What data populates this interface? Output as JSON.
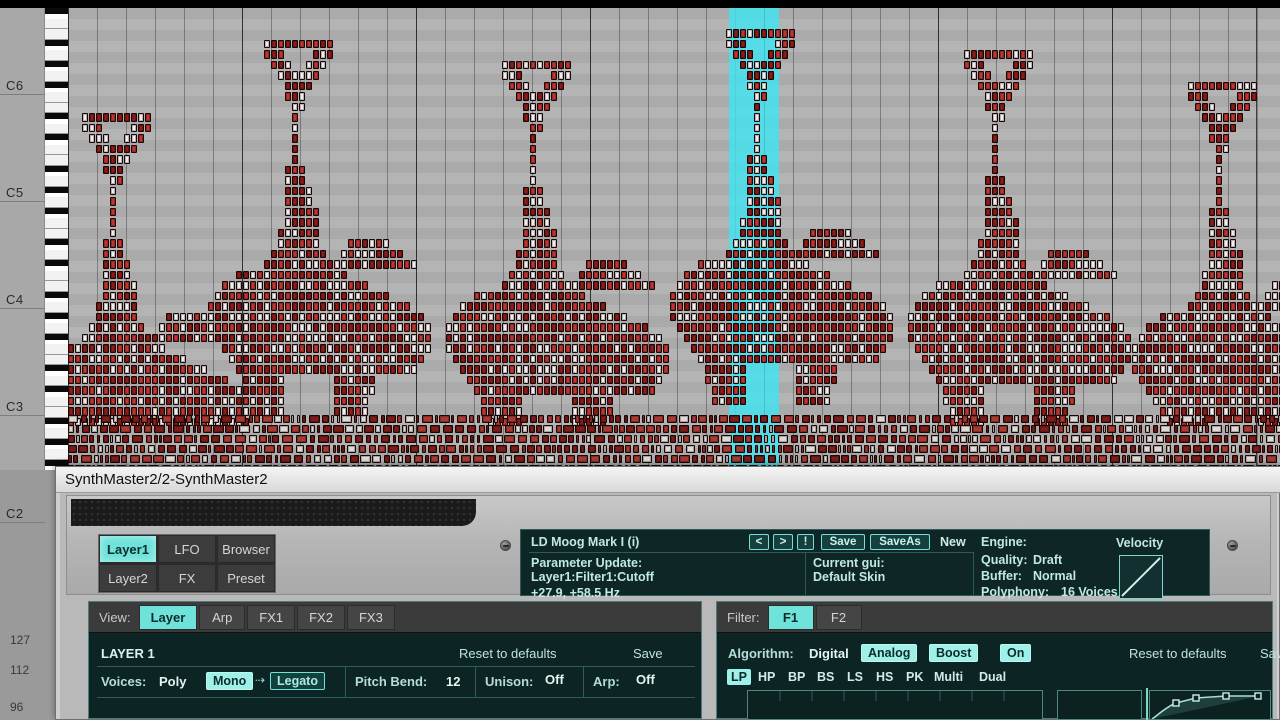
{
  "daw": {
    "octave_labels": [
      "C6",
      "C5",
      "C4",
      "C3",
      "C2"
    ],
    "velocity_labels": [
      "127",
      "112",
      "96"
    ],
    "selection_color": "#3fe4f2",
    "note_color": "#b02020",
    "grid_bg": "#b4b4b4"
  },
  "vst": {
    "window_title": "SynthMaster2/2-SynthMaster2",
    "layer_buttons": [
      {
        "label": "Layer1",
        "active": true
      },
      {
        "label": "LFO",
        "active": false
      },
      {
        "label": "Browser",
        "active": false
      },
      {
        "label": "Layer2",
        "active": false
      },
      {
        "label": "FX",
        "active": false
      },
      {
        "label": "Preset",
        "active": false
      }
    ],
    "lcd": {
      "preset_name": "LD Moog Mark I (i)",
      "nav_prev": "<",
      "nav_next": ">",
      "nav_info": "!",
      "save_label": "Save",
      "saveas_label": "SaveAs",
      "new_label": "New",
      "param_update_label": "Parameter Update:",
      "param_path": "Layer1:Filter1:Cutoff",
      "param_value": "+27.9, +58.5 Hz",
      "current_gui_label": "Current gui:",
      "current_gui_value": "Default Skin",
      "engine_label": "Engine:",
      "quality_label": "Quality:",
      "quality_value": "Draft",
      "buffer_label": "Buffer:",
      "buffer_value": "Normal",
      "polyphony_label": "Polyphony:",
      "polyphony_value": "16 Voices",
      "velocity_label": "Velocity"
    },
    "left_panel": {
      "tab_label": "View:",
      "tabs": [
        {
          "label": "Layer",
          "active": true
        },
        {
          "label": "Arp",
          "active": false
        },
        {
          "label": "FX1",
          "active": false
        },
        {
          "label": "FX2",
          "active": false
        },
        {
          "label": "FX3",
          "active": false
        }
      ],
      "section_title": "LAYER 1",
      "reset_label": "Reset to defaults",
      "save_label": "Save",
      "voices_label": "Voices:",
      "voices_poly": "Poly",
      "voices_mono": "Mono",
      "voices_legato": "Legato",
      "pitch_bend_label": "Pitch Bend:",
      "pitch_bend_value": "12",
      "unison_label": "Unison:",
      "unison_value": "Off",
      "arp_label": "Arp:",
      "arp_value": "Off"
    },
    "right_panel": {
      "tab_label": "Filter:",
      "tabs": [
        {
          "label": "F1",
          "active": true
        },
        {
          "label": "F2",
          "active": false
        }
      ],
      "algorithm_label": "Algorithm:",
      "algorithm_digital": "Digital",
      "algorithm_analog": "Analog",
      "boost_label": "Boost",
      "boost_state": "On",
      "reset_label": "Reset to defaults",
      "save_label": "Save",
      "filter_types": [
        {
          "label": "LP",
          "active": true
        },
        {
          "label": "HP",
          "active": false
        },
        {
          "label": "BP",
          "active": false
        },
        {
          "label": "BS",
          "active": false
        },
        {
          "label": "LS",
          "active": false
        },
        {
          "label": "HS",
          "active": false
        },
        {
          "label": "PK",
          "active": false
        },
        {
          "label": "Multi",
          "active": false
        },
        {
          "label": "Dual",
          "active": false
        }
      ]
    }
  }
}
